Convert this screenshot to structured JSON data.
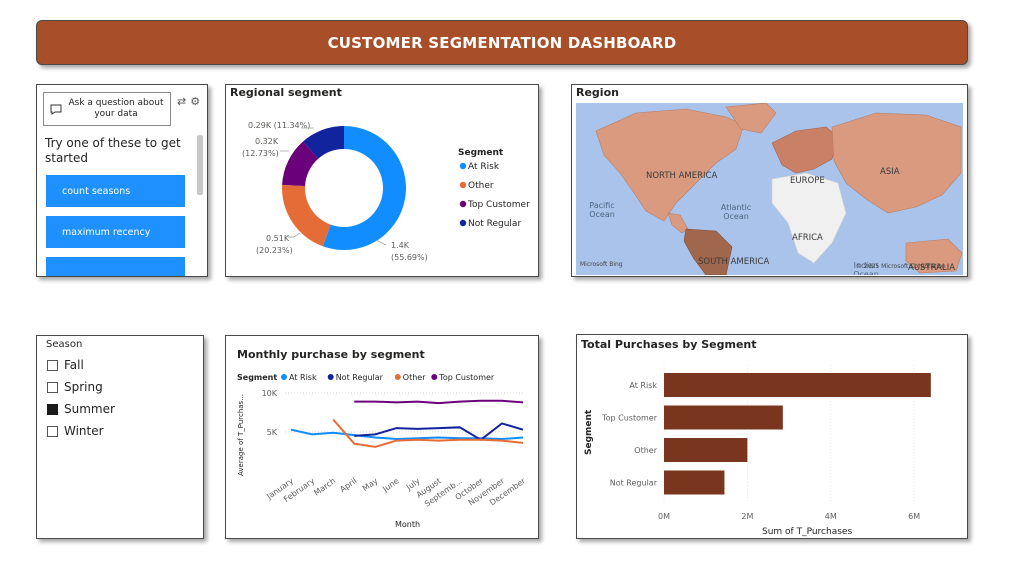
{
  "header": {
    "title": "CUSTOMER SEGMENTATION DASHBOARD"
  },
  "qa": {
    "ask_label": "Ask a question about your data",
    "try_label": "Try one of these to get started",
    "suggestions": [
      "count seasons",
      "maximum recency",
      ""
    ]
  },
  "donut": {
    "title": "Regional segment",
    "legend_title": "Segment",
    "labels": {
      "not_regular_value": "0.29K (11.34%)",
      "top_customer_value": "0.32K",
      "top_customer_pct": "(12.73%)",
      "other_value": "0.51K",
      "other_pct": "(20.23%)",
      "at_risk_value": "1.4K",
      "at_risk_pct": "(55.69%)"
    }
  },
  "map": {
    "title": "Region",
    "labels": {
      "north_america": "NORTH AMERICA",
      "europe": "EUROPE",
      "asia": "ASIA",
      "africa": "AFRICA",
      "south_america": "SOUTH AMERICA",
      "australia": "AUSTRALIA",
      "pacific": "Pacific Ocean",
      "atlantic": "Atlantic Ocean",
      "indian": "Indian Ocean",
      "bing": "Microsoft Bing",
      "copyright": "© 2025 Microsoft Corporation"
    }
  },
  "season": {
    "title": "Season",
    "options": [
      {
        "label": "Fall",
        "checked": false
      },
      {
        "label": "Spring",
        "checked": false
      },
      {
        "label": "Summer",
        "checked": true
      },
      {
        "label": "Winter",
        "checked": false
      }
    ]
  },
  "chart_data": [
    {
      "type": "pie",
      "title": "Regional segment",
      "legend_title": "Segment",
      "categories": [
        "At Risk",
        "Other",
        "Top Customer",
        "Not Regular"
      ],
      "values": [
        1400,
        510,
        320,
        290
      ],
      "percentages": [
        55.69,
        20.23,
        12.73,
        11.34
      ],
      "colors": [
        "#118dff",
        "#e66c37",
        "#6b007b",
        "#12239e"
      ],
      "legend_position": "right"
    },
    {
      "type": "line",
      "title": "Monthly purchase by segment",
      "legend_title": "Segment",
      "xlabel": "Month",
      "ylabel": "Average of T_Purchas...",
      "x": [
        "January",
        "February",
        "March",
        "April",
        "May",
        "June",
        "July",
        "August",
        "Septemb...",
        "October",
        "November",
        "December"
      ],
      "ylim": [
        0,
        10000
      ],
      "yticks": [
        "5K",
        "10K"
      ],
      "series": [
        {
          "name": "At Risk",
          "color": "#118dff",
          "values": [
            5300,
            4700,
            4900,
            4600,
            4300,
            4100,
            4200,
            4300,
            4200,
            4200,
            4100,
            4300
          ]
        },
        {
          "name": "Not Regular",
          "color": "#12239e",
          "values": [
            null,
            null,
            null,
            4500,
            4700,
            5500,
            5400,
            5500,
            5600,
            4000,
            6100,
            5300
          ]
        },
        {
          "name": "Other",
          "color": "#e66c37",
          "values": [
            null,
            null,
            6600,
            3500,
            3100,
            3900,
            4000,
            3900,
            4000,
            4000,
            3900,
            3600
          ]
        },
        {
          "name": "Top Customer",
          "color": "#6b007b",
          "values": [
            null,
            null,
            null,
            8900,
            8900,
            8800,
            8900,
            8700,
            8900,
            9000,
            9000,
            8800
          ]
        }
      ],
      "legend_position": "top-left"
    },
    {
      "type": "bar",
      "orientation": "horizontal",
      "title": "Total Purchases by Segment",
      "categories": [
        "At Risk",
        "Top Customer",
        "Other",
        "Not Regular"
      ],
      "values": [
        6400000,
        2850000,
        2000000,
        1450000
      ],
      "xlim": [
        0,
        6500000
      ],
      "xticks": [
        "0M",
        "2M",
        "4M",
        "6M"
      ],
      "xlabel": "Sum of T_Purchases",
      "ylabel": "Segment",
      "color": "#7a351e"
    }
  ]
}
